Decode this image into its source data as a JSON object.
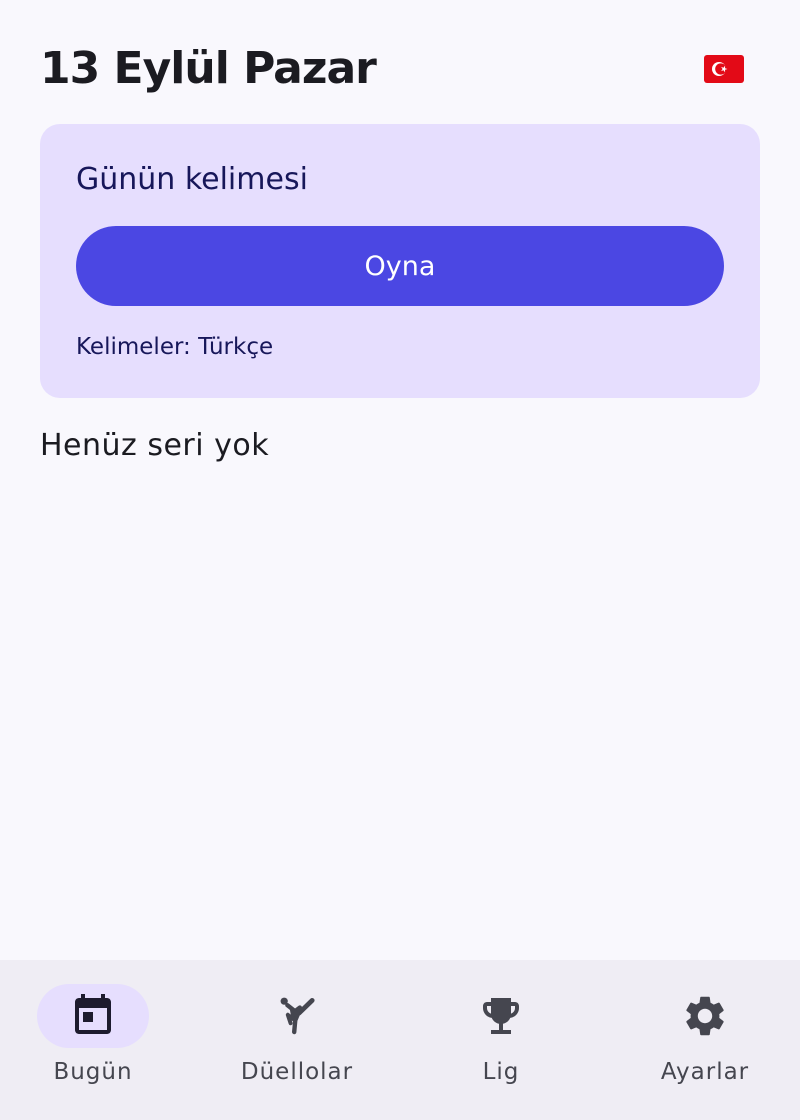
{
  "header": {
    "date_title": "13 Eylül Pazar",
    "language_flag": {
      "icon": "turkey-flag-icon",
      "color": "#e30a17"
    }
  },
  "daily_card": {
    "title": "Günün kelimesi",
    "play_label": "Oyna",
    "words_language": "Kelimeler: Türkçe"
  },
  "streak": {
    "empty_text": "Henüz seri yok"
  },
  "bottom_nav": {
    "items": [
      {
        "label": "Bugün",
        "icon": "calendar-icon",
        "active": true
      },
      {
        "label": "Düellolar",
        "icon": "martial-arts-icon",
        "active": false
      },
      {
        "label": "Lig",
        "icon": "trophy-icon",
        "active": false
      },
      {
        "label": "Ayarlar",
        "icon": "gear-icon",
        "active": false
      }
    ]
  },
  "colors": {
    "background": "#f9f8fd",
    "card": "#e6defe",
    "accent": "#4b47e3",
    "nav_background": "#efedf4",
    "text": "#1b1b21"
  }
}
